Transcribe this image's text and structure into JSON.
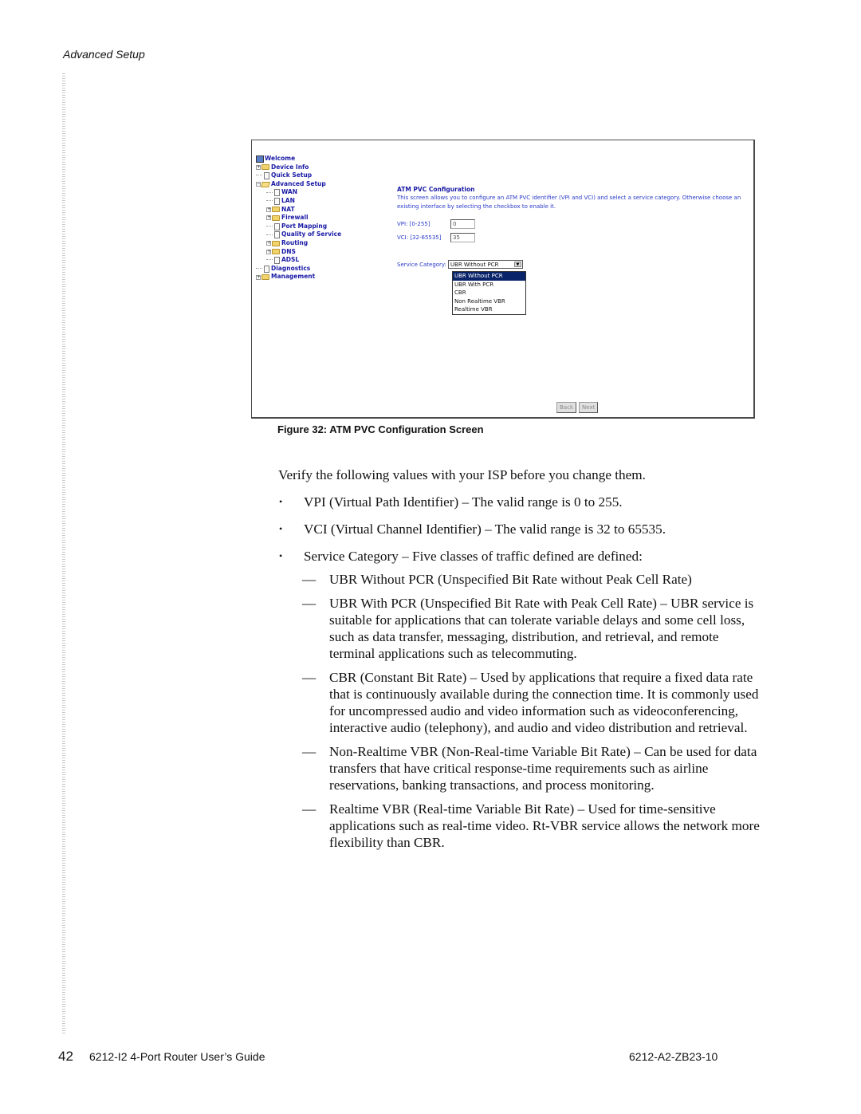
{
  "running_head": "Advanced Setup",
  "figure": {
    "caption": "Figure 32: ATM PVC Configuration Screen",
    "tree": [
      {
        "label": "Welcome",
        "icon": "monitor-icon",
        "indent": 0,
        "expander": ""
      },
      {
        "label": "Device Info",
        "icon": "folder-icon",
        "indent": 0,
        "expander": "+"
      },
      {
        "label": "Quick Setup",
        "icon": "document-icon",
        "indent": 0,
        "expander": ""
      },
      {
        "label": "Advanced Setup",
        "icon": "folder-open-icon",
        "indent": 0,
        "expander": "-"
      },
      {
        "label": "WAN",
        "icon": "document-icon",
        "indent": 1,
        "expander": ""
      },
      {
        "label": "LAN",
        "icon": "document-icon",
        "indent": 1,
        "expander": ""
      },
      {
        "label": "NAT",
        "icon": "folder-icon",
        "indent": 1,
        "expander": "+"
      },
      {
        "label": "Firewall",
        "icon": "folder-icon",
        "indent": 1,
        "expander": "+"
      },
      {
        "label": "Port Mapping",
        "icon": "document-icon",
        "indent": 1,
        "expander": ""
      },
      {
        "label": "Quality of Service",
        "icon": "document-icon",
        "indent": 1,
        "expander": ""
      },
      {
        "label": "Routing",
        "icon": "folder-icon",
        "indent": 1,
        "expander": "+"
      },
      {
        "label": "DNS",
        "icon": "folder-icon",
        "indent": 1,
        "expander": "+"
      },
      {
        "label": "ADSL",
        "icon": "document-icon",
        "indent": 1,
        "expander": ""
      },
      {
        "label": "Diagnostics",
        "icon": "document-icon",
        "indent": 0,
        "expander": ""
      },
      {
        "label": "Management",
        "icon": "folder-icon",
        "indent": 0,
        "expander": "+"
      }
    ],
    "content": {
      "title": "ATM PVC Configuration",
      "description": "This screen allows you to configure an ATM PVC identifier (VPI and VCI) and select a service category. Otherwise choose an existing interface by selecting the checkbox to enable it.",
      "vpi_label": "VPI: [0-255]",
      "vpi_value": "0",
      "vci_label": "VCI: [32-65535]",
      "vci_value": "35",
      "service_label": "Service Category:",
      "service_selected": "UBR Without PCR",
      "service_options": [
        "UBR Without PCR",
        "UBR With PCR",
        "CBR",
        "Non Realtime VBR",
        "Realtime VBR"
      ],
      "back_label": "Back",
      "next_label": "Next"
    }
  },
  "body": {
    "intro": "Verify the following values with your ISP before you change them.",
    "bullets": [
      "VPI (Virtual Path Identifier) – The valid range is 0 to 255.",
      "VCI  (Virtual Channel Identifier) – The valid range is 32 to 65535.",
      "Service Category – Five classes of traffic defined are defined:"
    ],
    "dash_mark": "—",
    "classes": [
      "UBR Without PCR (Unspecified Bit Rate without Peak Cell Rate)",
      "UBR With PCR (Unspecified Bit Rate with Peak Cell Rate) – UBR service is suitable for applications that can tolerate variable delays and some cell loss, such as data transfer, messaging, distribution, and retrieval, and  remote terminal applications such as telecommuting.",
      "CBR (Constant Bit Rate) – Used by applications that require a fixed data rate that is continuously available during the connection time. It is commonly used for uncompressed audio and video information such as videoconferencing, interactive audio (telephony), and audio and video distribution and retrieval.",
      "Non-Realtime VBR (Non-Real-time Variable Bit Rate) – Can be used for data transfers that have critical response-time requirements such as airline reservations, banking transactions, and process monitoring.",
      "Realtime VBR  (Real-time Variable Bit Rate) – Used for time-sensitive applications such as real-time video. Rt-VBR service allows the network more flexibility than CBR."
    ]
  },
  "footer": {
    "page_number": "42",
    "guide_title": "6212-I2 4-Port Router User’s Guide",
    "doc_number": "6212-A2-ZB23-10"
  }
}
